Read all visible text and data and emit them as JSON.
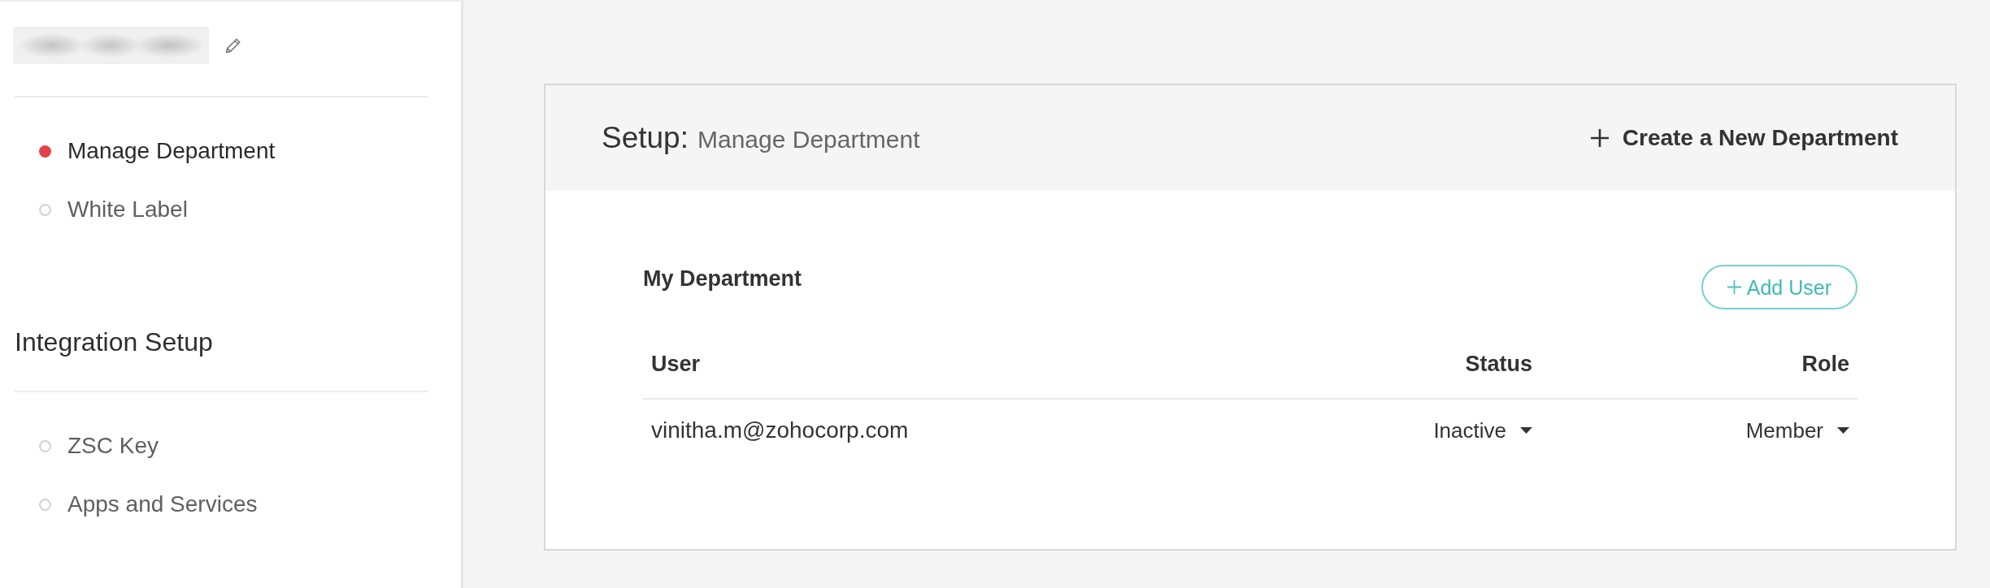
{
  "sidebar": {
    "profile": {
      "name_blurred": true
    },
    "sections": [
      {
        "items": [
          {
            "label": "Manage Department",
            "selected": true
          },
          {
            "label": "White Label",
            "selected": false
          }
        ]
      },
      {
        "title": "Integration Setup",
        "items": [
          {
            "label": "ZSC Key",
            "selected": false
          },
          {
            "label": "Apps and Services",
            "selected": false
          }
        ]
      }
    ]
  },
  "panel": {
    "heading": "Setup:",
    "subheading": "Manage Department",
    "create_action": "Create a New Department",
    "section_title": "My Department",
    "add_button": "Add User",
    "table": {
      "columns": [
        "User",
        "Status",
        "Role"
      ],
      "rows": [
        {
          "user": "vinitha.m@zohocorp.com",
          "status": "Inactive",
          "role": "Member"
        }
      ]
    }
  }
}
